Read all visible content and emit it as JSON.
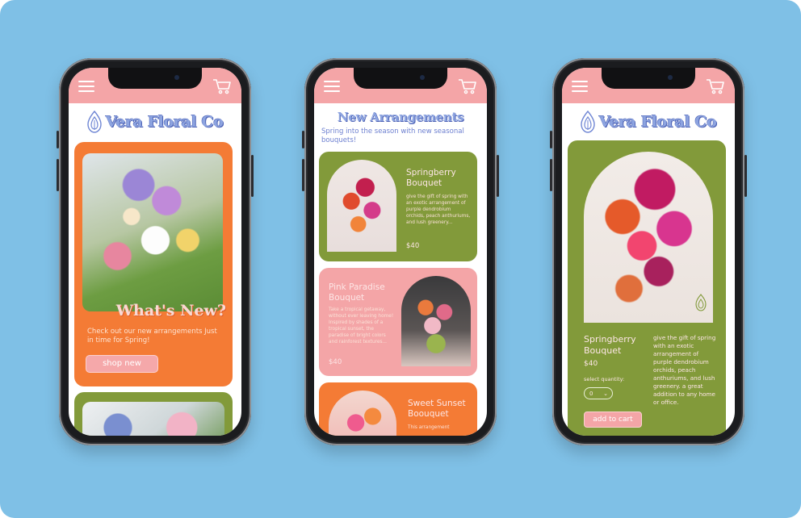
{
  "brand": {
    "name": "Vera Floral Co"
  },
  "colors": {
    "background": "#7fc0e6",
    "topbar": "#f4a5a7",
    "orange": "#f47b35",
    "green": "#829a3a",
    "pink": "#f4a5a7",
    "title_blue": "#8da4e0"
  },
  "icons": {
    "menu": "hamburger-menu-icon",
    "cart": "shopping-cart-icon",
    "logo": "lotus-logo-icon",
    "dropdown": "chevron-down-icon"
  },
  "home": {
    "headline": "What's New?",
    "subtext": "Check out our new arrangements Just in time for Spring!",
    "shop_button": "shop new"
  },
  "arrangements": {
    "title": "New Arrangements",
    "subtitle": "Spring into the season with new seasonal bouquets!",
    "products": [
      {
        "name": "Springberry Bouquet",
        "description": "give the gift of spring with an exotic arrangement of purple dendrobium orchids, peach anthuriums, and lush greenery...",
        "price": "$40"
      },
      {
        "name": "Pink Paradise Bouquet",
        "description": "Take a tropical getaway, without ever leaving home! Inspired by shades of a tropical sunset, the paradise of bright colors and rainforest textures...",
        "price": "$40"
      },
      {
        "name": "Sweet Sunset Boouquet",
        "description": "This arrangement",
        "price": ""
      }
    ]
  },
  "detail": {
    "name": "Springberry Bouquet",
    "price": "$40",
    "quantity_label": "select quantity:",
    "quantity_value": "0",
    "add_button": "add to cart",
    "description": "give the gift of spring with an exotic arrangement of purple dendrobium orchids, peach anthuriums, and lush greenery. a great addition to any home or office."
  }
}
